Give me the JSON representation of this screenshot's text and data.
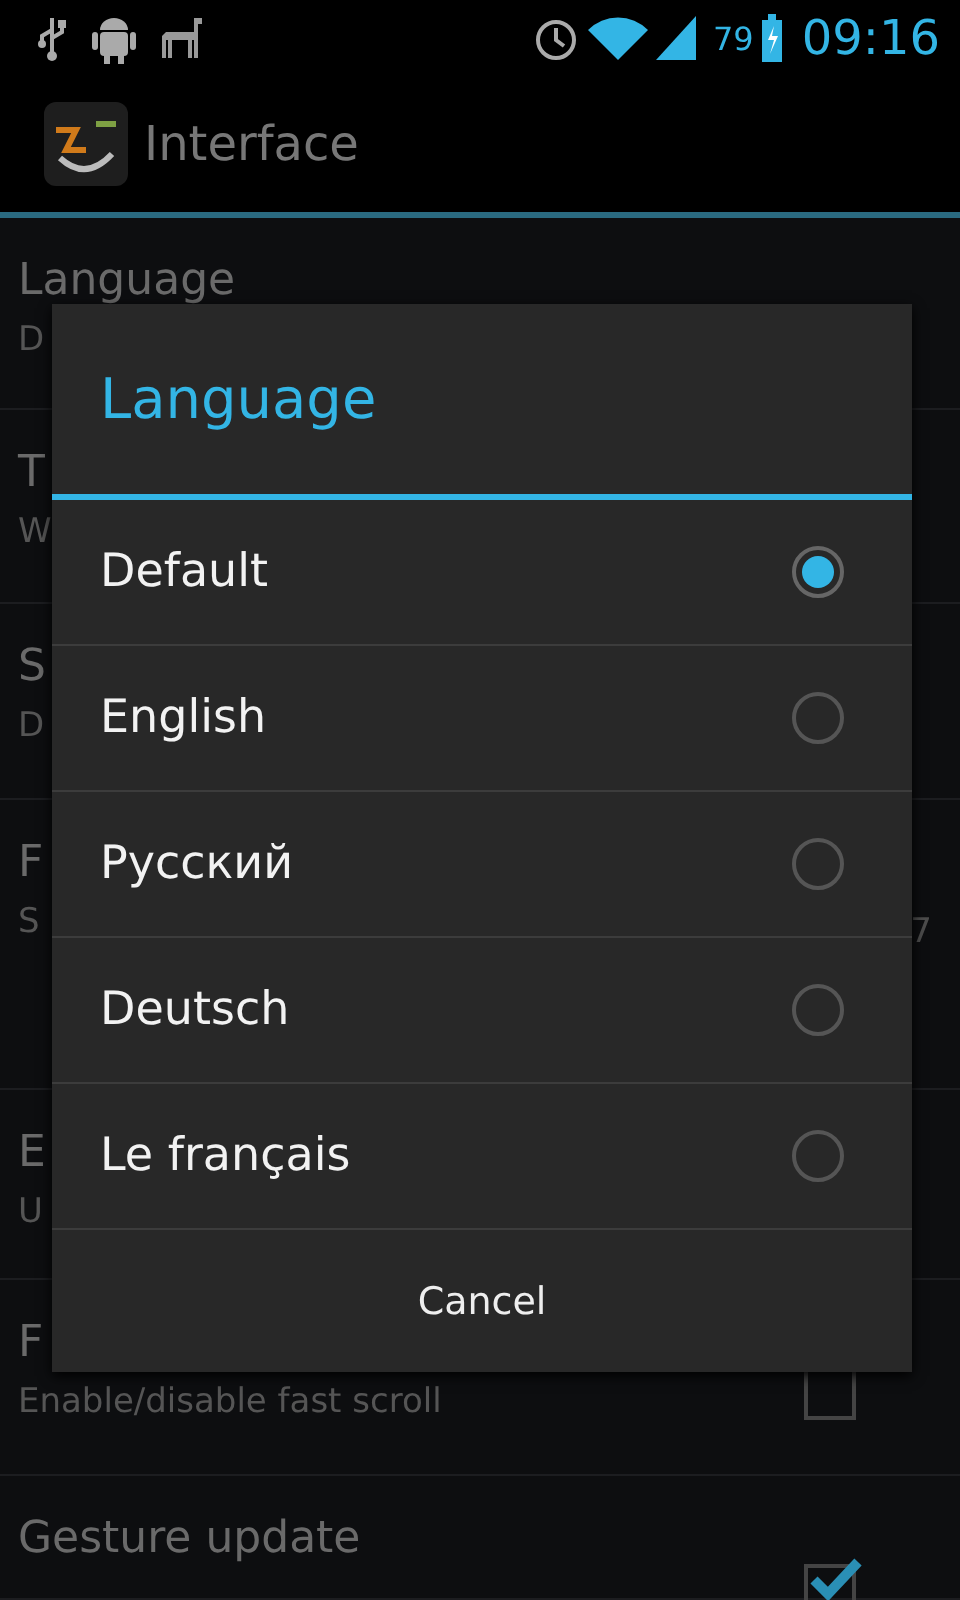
{
  "status_bar": {
    "battery_text": "79",
    "time": "09:16"
  },
  "action_bar": {
    "title": "Interface"
  },
  "settings": [
    {
      "title": "Language",
      "summary": "D"
    },
    {
      "title": "T",
      "summary": "W"
    },
    {
      "title": "S",
      "summary": "D"
    },
    {
      "title": "F",
      "summary": "S",
      "trailing": "7"
    },
    {
      "title": "E",
      "summary": "U"
    },
    {
      "title": "F",
      "summary": "Enable/disable fast scroll",
      "kind": "checkbox",
      "checked": false
    },
    {
      "title": "Gesture update",
      "kind": "checkbox",
      "checked": true
    }
  ],
  "dialog": {
    "title": "Language",
    "options": [
      {
        "label": "Default",
        "selected": true
      },
      {
        "label": "English",
        "selected": false
      },
      {
        "label": "Русский",
        "selected": false
      },
      {
        "label": "Deutsch",
        "selected": false
      },
      {
        "label": "Le français",
        "selected": false
      }
    ],
    "cancel": "Cancel"
  }
}
